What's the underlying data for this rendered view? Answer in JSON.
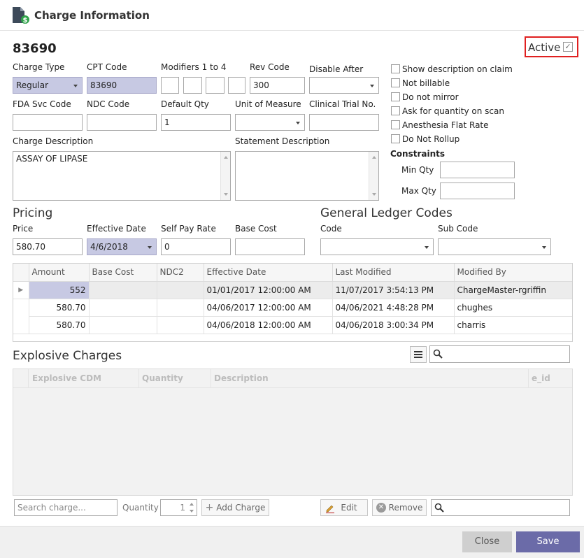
{
  "window": {
    "title": "Charge Information"
  },
  "header": {
    "charge_code": "83690",
    "active_label": "Active",
    "active_checked": true
  },
  "fields": {
    "charge_type": {
      "label": "Charge Type",
      "value": "Regular"
    },
    "cpt_code": {
      "label": "CPT Code",
      "value": "83690"
    },
    "modifiers": {
      "label": "Modifiers 1 to 4",
      "values": [
        "",
        "",
        "",
        ""
      ]
    },
    "rev_code": {
      "label": "Rev Code",
      "value": "300"
    },
    "disable_after": {
      "label": "Disable After",
      "value": ""
    },
    "fda_svc_code": {
      "label": "FDA Svc Code",
      "value": ""
    },
    "ndc_code": {
      "label": "NDC Code",
      "value": ""
    },
    "default_qty": {
      "label": "Default Qty",
      "value": "1"
    },
    "unit_of_measure": {
      "label": "Unit of Measure",
      "value": ""
    },
    "clinical_trial_no": {
      "label": "Clinical Trial No.",
      "value": ""
    },
    "charge_description": {
      "label": "Charge Description",
      "value": "ASSAY OF LIPASE"
    },
    "statement_description": {
      "label": "Statement Description",
      "value": ""
    }
  },
  "options": [
    {
      "label": "Show description on claim",
      "checked": false
    },
    {
      "label": "Not billable",
      "checked": false
    },
    {
      "label": "Do not mirror",
      "checked": false
    },
    {
      "label": "Ask for quantity on scan",
      "checked": false
    },
    {
      "label": "Anesthesia Flat Rate",
      "checked": false
    },
    {
      "label": "Do Not Rollup",
      "checked": false
    }
  ],
  "constraints": {
    "title": "Constraints",
    "min_label": "Min Qty",
    "min_value": "",
    "max_label": "Max Qty",
    "max_value": ""
  },
  "pricing": {
    "title": "Pricing",
    "price": {
      "label": "Price",
      "value": "580.70"
    },
    "effective_date": {
      "label": "Effective Date",
      "value": "4/6/2018"
    },
    "self_pay_rate": {
      "label": "Self Pay Rate",
      "value": "0"
    },
    "base_cost": {
      "label": "Base Cost",
      "value": ""
    }
  },
  "gl": {
    "title": "General Ledger Codes",
    "code_label": "Code",
    "code_value": "",
    "sub_label": "Sub Code",
    "sub_value": ""
  },
  "price_table": {
    "columns": [
      "Amount",
      "Base Cost",
      "NDC2",
      "Effective Date",
      "Last Modified",
      "Modified By"
    ],
    "rows": [
      [
        "552",
        "",
        "",
        "01/01/2017 12:00:00 AM",
        "11/07/2017 3:54:13 PM",
        "ChargeMaster-rgriffin"
      ],
      [
        "580.70",
        "",
        "",
        "04/06/2017 12:00:00 AM",
        "04/06/2021 4:48:28 PM",
        "chughes"
      ],
      [
        "580.70",
        "",
        "",
        "04/06/2018 12:00:00 AM",
        "04/06/2018 3:00:34 PM",
        "charris"
      ]
    ]
  },
  "explosive": {
    "title": "Explosive Charges",
    "search_value": "",
    "columns": [
      "Explosive CDM",
      "Quantity",
      "Description",
      "e_id"
    ],
    "search_charge_placeholder": "Search charge...",
    "quantity_label": "Quantity",
    "quantity_value": "1",
    "add_charge_label": "Add Charge",
    "edit_label": "Edit",
    "remove_label": "Remove",
    "bottom_search_value": ""
  },
  "footer": {
    "close_label": "Close",
    "save_label": "Save"
  },
  "colors": {
    "accent": "#6b6ba8",
    "highlight_box": "#e02020",
    "shaded_field": "#c7c9e3"
  }
}
